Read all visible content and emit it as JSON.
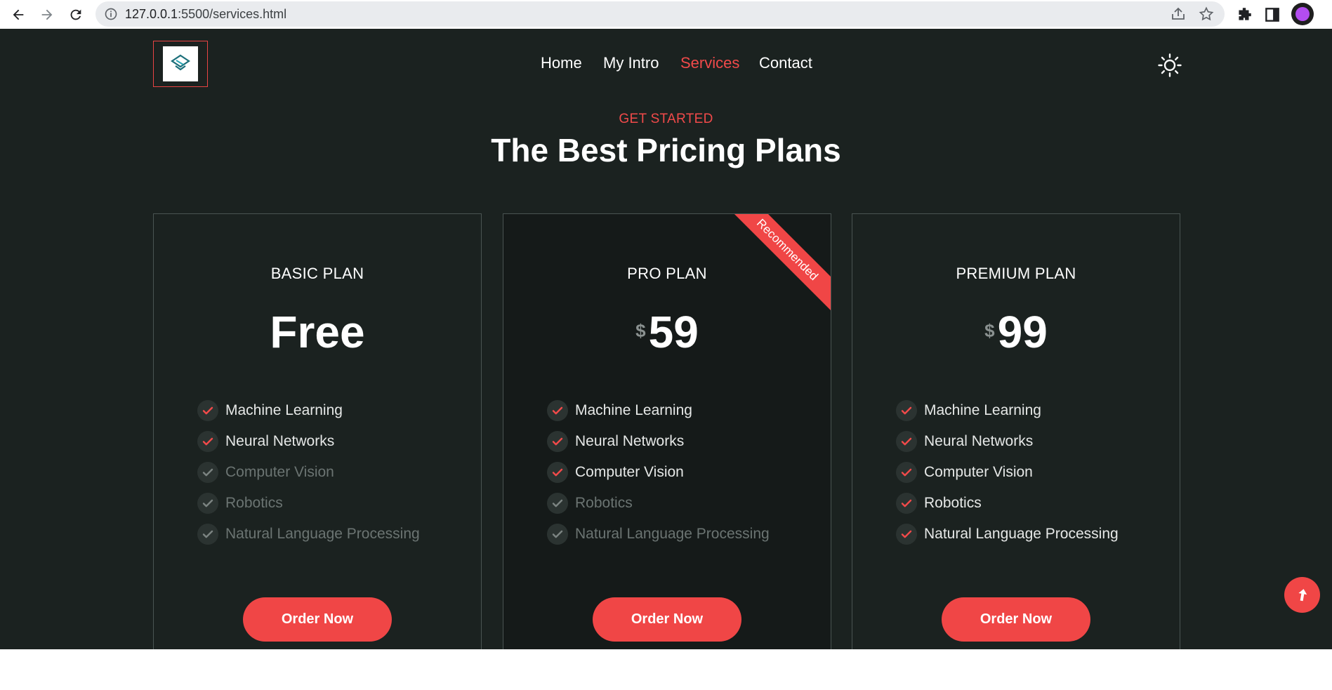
{
  "browser": {
    "url_host": "127.0.0.1",
    "url_path": ":5500/services.html",
    "back_icon": "back-arrow-icon",
    "forward_icon": "forward-arrow-icon",
    "reload_icon": "reload-icon"
  },
  "nav": {
    "items": [
      {
        "label": "Home"
      },
      {
        "label": "My Intro"
      },
      {
        "label": "Services",
        "active": true
      },
      {
        "label": "Contact"
      }
    ]
  },
  "hero": {
    "eyebrow": "GET STARTED",
    "title": "The Best Pricing Plans"
  },
  "plans": [
    {
      "name": "BASIC PLAN",
      "currency": "",
      "price": "Free",
      "features": [
        {
          "label": "Machine Learning",
          "included": true
        },
        {
          "label": "Neural Networks",
          "included": true
        },
        {
          "label": "Computer Vision",
          "included": false
        },
        {
          "label": "Robotics",
          "included": false
        },
        {
          "label": "Natural Language Processing",
          "included": false
        }
      ],
      "button": "Order Now"
    },
    {
      "name": "PRO PLAN",
      "currency": "$",
      "price": "59",
      "ribbon": "Recommended",
      "features": [
        {
          "label": "Machine Learning",
          "included": true
        },
        {
          "label": "Neural Networks",
          "included": true
        },
        {
          "label": "Computer Vision",
          "included": true
        },
        {
          "label": "Robotics",
          "included": false
        },
        {
          "label": "Natural Language Processing",
          "included": false
        }
      ],
      "button": "Order Now"
    },
    {
      "name": "PREMIUM PLAN",
      "currency": "$",
      "price": "99",
      "features": [
        {
          "label": "Machine Learning",
          "included": true
        },
        {
          "label": "Neural Networks",
          "included": true
        },
        {
          "label": "Computer Vision",
          "included": true
        },
        {
          "label": "Robotics",
          "included": true
        },
        {
          "label": "Natural Language Processing",
          "included": true
        }
      ],
      "button": "Order Now"
    }
  ],
  "colors": {
    "accent": "#f04646",
    "background": "#1b2220",
    "check_on": "#f14a4a",
    "check_off": "#7c8482"
  }
}
